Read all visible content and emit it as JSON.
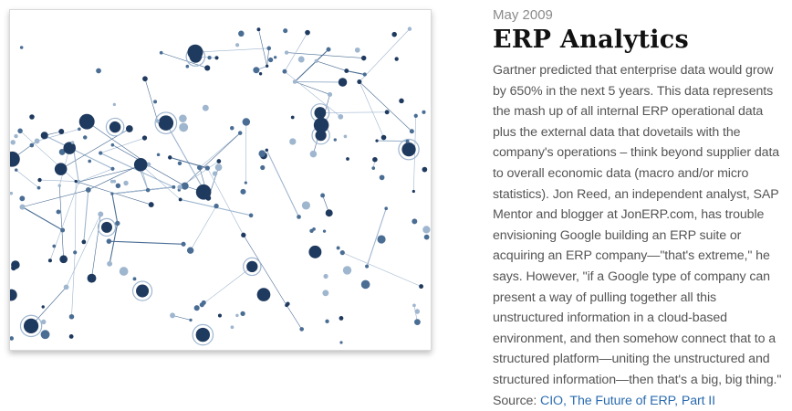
{
  "article": {
    "date": "May 2009",
    "title": "ERP Analytics",
    "body": "Gartner predicted that enterprise data would grow by 650% in the next 5 years. This data represents the mash up of all internal ERP operational data plus the external data that dovetails with the company's operations – think beyond supplier data to overall economic data (macro and/or micro statistics). Jon Reed, an independent analyst, SAP Mentor and blogger at JonERP.com, has trouble envisioning Google building an ERP suite or acquiring an ERP company—\"that's extreme,\" he says. However, \"if a Google type of company can present a way of pulling together all this unstructured information in a cloud-based environment, and then somehow connect that to a structured platform—uniting the unstructured and structured information—then that's a big, big thing.\" Source: ",
    "source_link": "CIO, The Future of ERP, Part II"
  },
  "image": {
    "description": "network-graph-illustration",
    "colors": {
      "dark": "#1f3a5f",
      "mid": "#4a6d94",
      "light": "#9fb6cf"
    }
  }
}
